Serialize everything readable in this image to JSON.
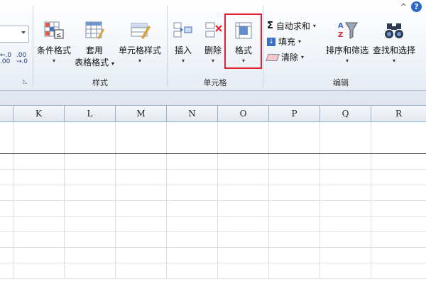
{
  "ribbon": {
    "styles_group": {
      "label": "样式",
      "buttons": [
        {
          "line1": "条件格式",
          "line2": ""
        },
        {
          "line1": "套用",
          "line2": "表格格式"
        },
        {
          "line1": "单元格样式",
          "line2": ""
        }
      ]
    },
    "cells_group": {
      "label": "单元格",
      "buttons": [
        {
          "line1": "插入"
        },
        {
          "line1": "删除"
        },
        {
          "line1": "格式"
        }
      ]
    },
    "editing_group": {
      "label": "编辑",
      "small_buttons": [
        {
          "icon": "sum-icon",
          "label": "自动求和"
        },
        {
          "icon": "fill-icon",
          "label": "填充"
        },
        {
          "icon": "eraser-icon",
          "label": "清除"
        }
      ],
      "buttons": [
        {
          "line1": "排序和筛选"
        },
        {
          "line1": "查找和选择"
        }
      ]
    },
    "number_format_decimals": {
      "increase": "+.0\n.00",
      "decrease": ".00\n+.0"
    },
    "sigma": "Σ",
    "help": "?",
    "collapse": "^"
  },
  "sheet": {
    "columns": [
      "K",
      "L",
      "M",
      "N",
      "O",
      "P",
      "Q",
      "R"
    ]
  },
  "colors": {
    "highlight": "#e4202f",
    "accent": "#2a66c9"
  }
}
